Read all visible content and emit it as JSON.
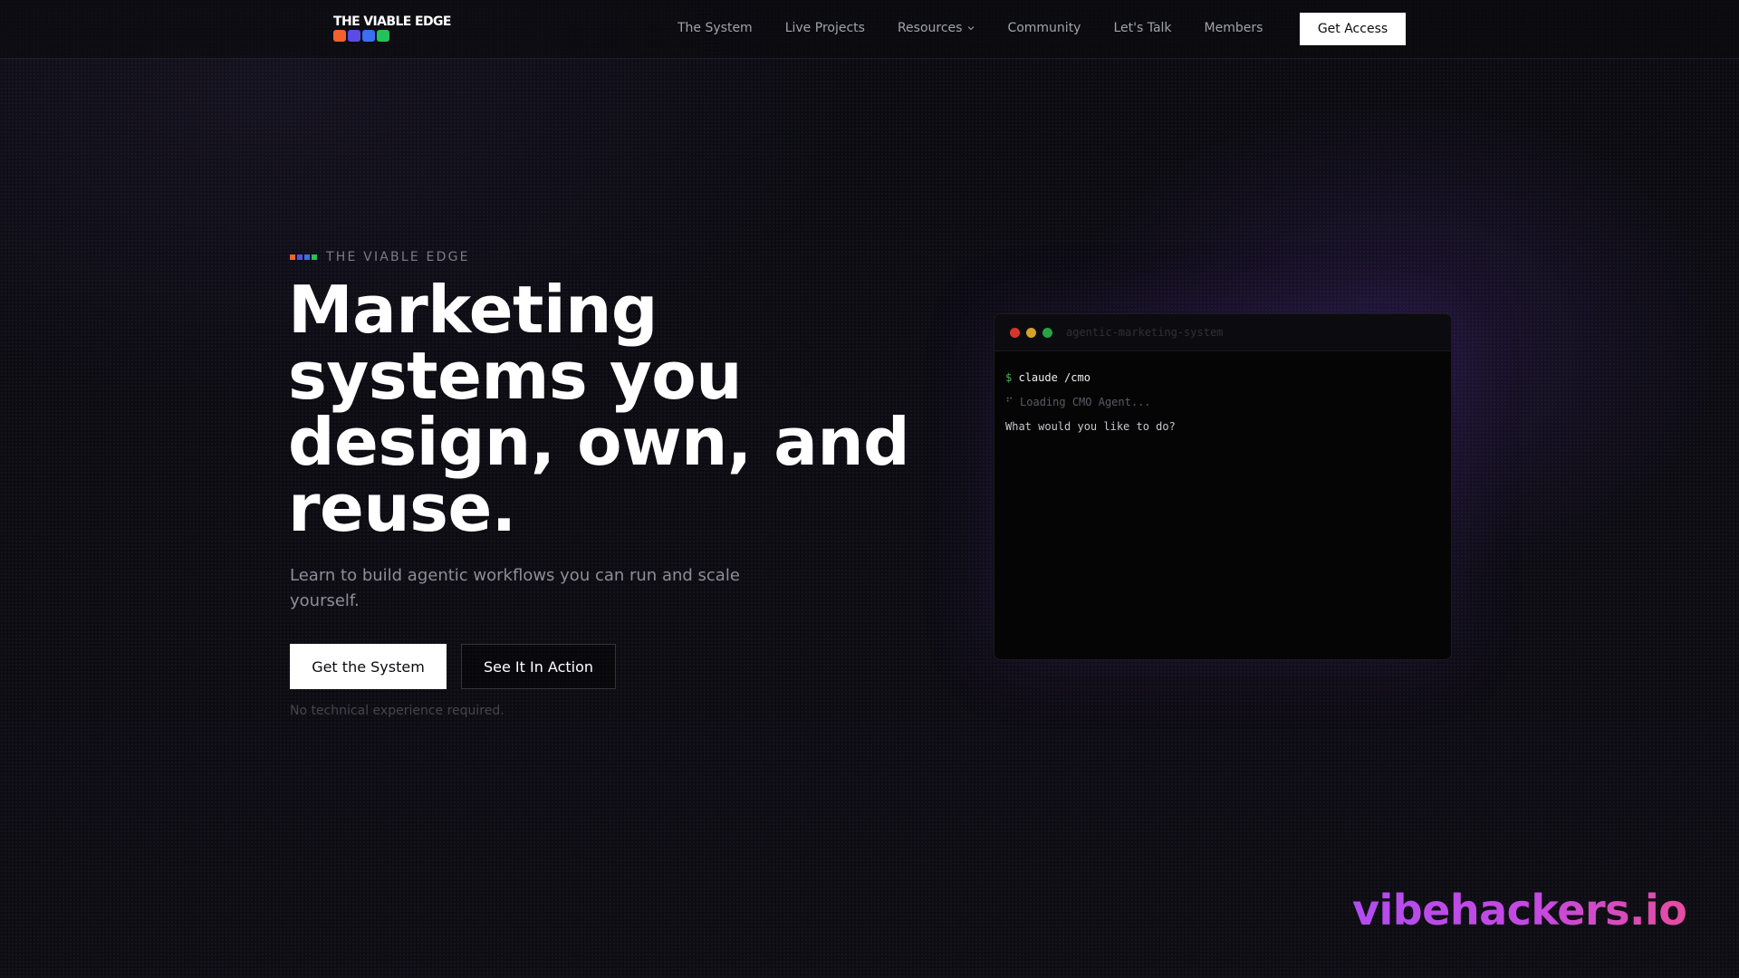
{
  "brand": {
    "logo_text": "THE VIABLE EDGE",
    "logo_blocks": [
      "#f2622c",
      "#5a4de6",
      "#3b6ef0",
      "#24c25a"
    ]
  },
  "nav": {
    "links": [
      {
        "label": "The System"
      },
      {
        "label": "Live Projects"
      },
      {
        "label": "Resources",
        "has_dropdown": true
      },
      {
        "label": "Community"
      },
      {
        "label": "Let's Talk"
      },
      {
        "label": "Members"
      }
    ],
    "cta_label": "Get Access"
  },
  "hero": {
    "eyebrow": "THE VIABLE EDGE",
    "eyebrow_blocks": [
      "#f2622c",
      "#5a4de6",
      "#3b6ef0",
      "#24c25a"
    ],
    "headline": "Marketing systems you design, own, and reuse.",
    "subhead": "Learn to build agentic workflows you can run and scale yourself.",
    "primary_button": "Get the System",
    "secondary_button": "See It In Action",
    "note": "No technical experience required."
  },
  "terminal": {
    "title": "agentic-marketing-system",
    "dots": [
      "#d9342b",
      "#d5a12a",
      "#2aa243"
    ],
    "prompt_symbol": "$",
    "command": "claude /cmo",
    "loading_symbol": "⠋",
    "loading_text": "Loading CMO Agent...",
    "question": "What would you like to do?"
  },
  "watermark": "vibehackers.io",
  "colors": {
    "background": "#0b0a10",
    "accent_purple": "#b24cf0",
    "accent_pink": "#e64ca0"
  },
  "icons": {
    "dropdown": "chevron-down-icon"
  }
}
